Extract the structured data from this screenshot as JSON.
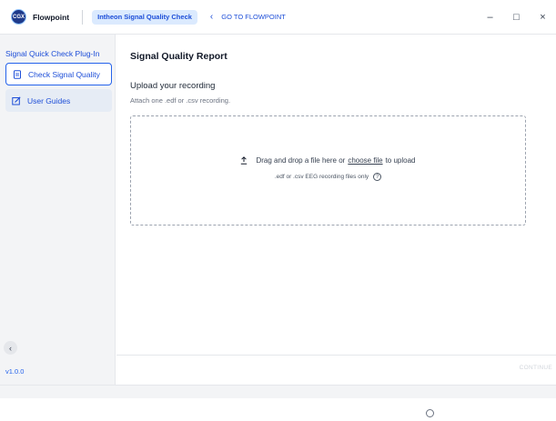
{
  "app": {
    "brand_logo_text": "CGX",
    "brand_name": "Flowpoint",
    "plugin_tab": "Intheon Signal Quality Check",
    "goto_label": "GO TO FLOWPOINT",
    "window_controls": {
      "minimize": "–",
      "maximize": "□",
      "close": "×"
    }
  },
  "sidebar": {
    "heading": "Signal Quick Check Plug-In",
    "items": [
      {
        "label": "Check Signal Quality",
        "icon": "document-icon",
        "active": true
      },
      {
        "label": "User Guides",
        "icon": "edit-icon",
        "active": false
      }
    ],
    "collapse_glyph": "‹",
    "version": "v1.0.0"
  },
  "main": {
    "title": "Signal Quality Report",
    "upload_title": "Upload your recording",
    "upload_subtitle": "Attach one .edf or .csv recording.",
    "dropzone": {
      "text_before": "Drag and drop a file here or",
      "link_text": "choose file",
      "text_after": "to upload",
      "hint": ".edf or .csv EEG recording files only",
      "help_glyph": "?"
    },
    "continue_label": "CONTINUE"
  },
  "colors": {
    "accent": "#2563eb",
    "accent_dark": "#1d4ed8",
    "plugin_tab_bg": "#dbeafe",
    "sidebar_bg": "#f3f4f6",
    "disabled_text": "#d1d5db"
  }
}
